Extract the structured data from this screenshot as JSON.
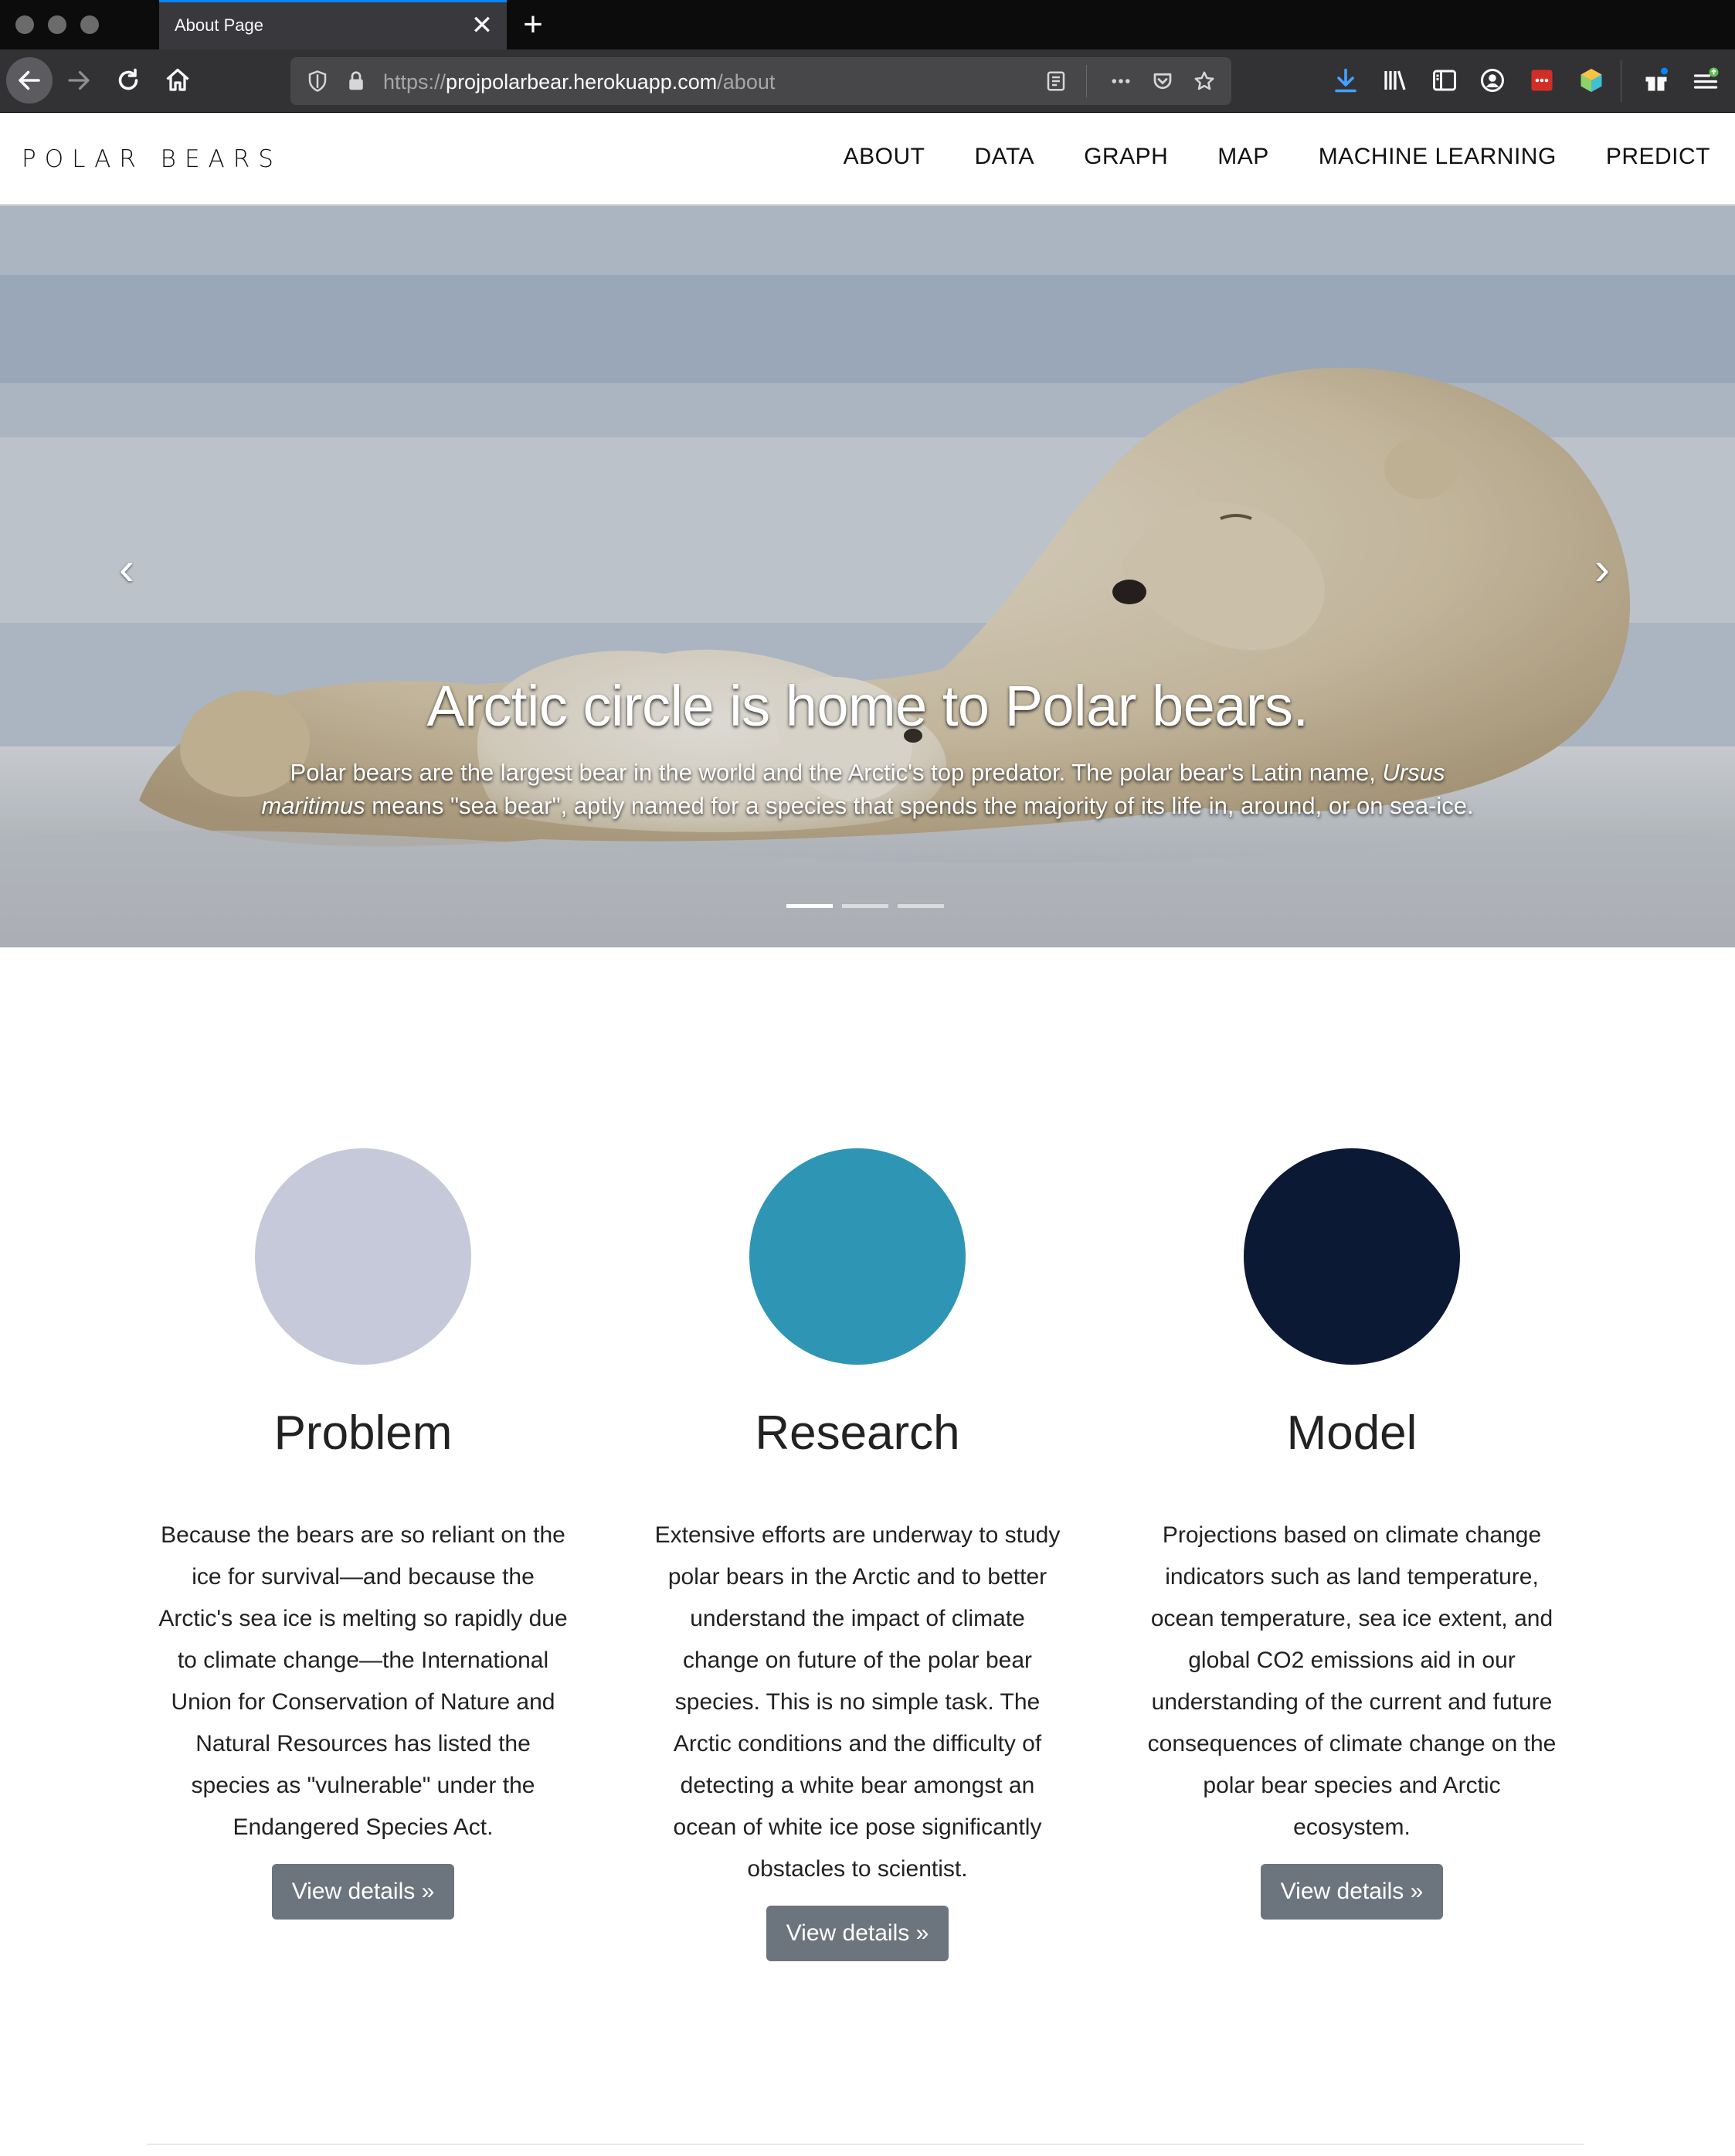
{
  "browser": {
    "tab_title": "About Page",
    "tab_close": "✕",
    "new_tab": "+",
    "url_scheme": "https://",
    "url_host": "projpolarbear.herokuapp.com",
    "url_path": "/about",
    "icons": [
      "back-icon",
      "forward-icon",
      "reload-icon",
      "home-icon",
      "tracking-shield-icon",
      "lock-icon",
      "reader-view-icon",
      "page-actions-icon",
      "pocket-icon",
      "bookmark-star-icon",
      "download-icon",
      "library-icon",
      "sidebar-icon",
      "account-icon",
      "lastpass-icon",
      "colorful-extension-icon",
      "whats-new-gift-icon",
      "menu-icon"
    ],
    "accent": "#0a84ff"
  },
  "site": {
    "brand": "POLAR BEARS",
    "nav": [
      "ABOUT",
      "DATA",
      "GRAPH",
      "MAP",
      "MACHINE LEARNING",
      "PREDICT"
    ]
  },
  "hero": {
    "heading": "Arctic circle is home to Polar bears.",
    "text_before": "Polar bears are the largest bear in the world and the Arctic's top predator. The polar bear's Latin name, ",
    "text_italic": "Ursus maritimus",
    "text_after": " means \"sea bear\", aptly named for a species that spends the majority of its life in, around, or on sea-ice.",
    "prev": "‹",
    "next": "›",
    "slide_count": 3,
    "active_slide": 1
  },
  "features": [
    {
      "title": "Problem",
      "color": "#c5c9da",
      "text": "Because the bears are so reliant on the ice for survival—and because the Arctic's sea ice is melting so rapidly due to climate change—the International Union for Conservation of Nature and Natural Resources has listed the species as \"vulnerable\" under the Endangered Species Act.",
      "button": "View details »"
    },
    {
      "title": "Research",
      "color": "#2e96b4",
      "text": "Extensive efforts are underway to study polar bears in the Arctic and to better understand the impact of climate change on future of the polar bear species. This is no simple task. The Arctic conditions and the difficulty of detecting a white bear amongst an ocean of white ice pose significantly obstacles to scientist.",
      "button": "View details »"
    },
    {
      "title": "Model",
      "color": "#0c1935",
      "text": "Projections based on climate change indicators such as land temperature, ocean temperature, sea ice extent, and global CO2 emissions aid in our understanding of the current and future consequences of climate change on the polar bear species and Arctic ecosystem.",
      "button": "View details »"
    }
  ]
}
